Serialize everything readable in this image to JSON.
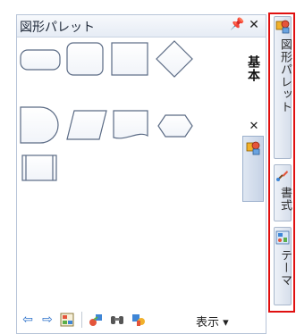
{
  "palette": {
    "title": "図形パレット",
    "pin_icon": "pin-icon",
    "close_icon": "close-icon",
    "inner_tab_label": "基本",
    "shapes": [
      {
        "name": "rounded-rectangle"
      },
      {
        "name": "rounded-square"
      },
      {
        "name": "square"
      },
      {
        "name": "diamond"
      },
      {
        "name": "delay"
      },
      {
        "name": "parallelogram"
      },
      {
        "name": "document"
      },
      {
        "name": "hexagon"
      },
      {
        "name": "predefined-process"
      }
    ]
  },
  "toolbar": {
    "view_label": "表示 ▾",
    "icons": [
      "arrow-left-icon",
      "arrow-right-icon",
      "stencil-icon",
      "shapes-link-icon",
      "binoculars-icon",
      "shape-style-icon"
    ]
  },
  "right_tabs": [
    {
      "label": "図形パレット",
      "icon": "shape-palette-icon"
    },
    {
      "label": "書式",
      "icon": "paintbrush-icon"
    },
    {
      "label": "テーマ",
      "icon": "theme-icon"
    }
  ],
  "colors": {
    "accent_red": "#e01010",
    "shape_stroke": "#5b6b85",
    "panel_border": "#b7c4d8"
  }
}
